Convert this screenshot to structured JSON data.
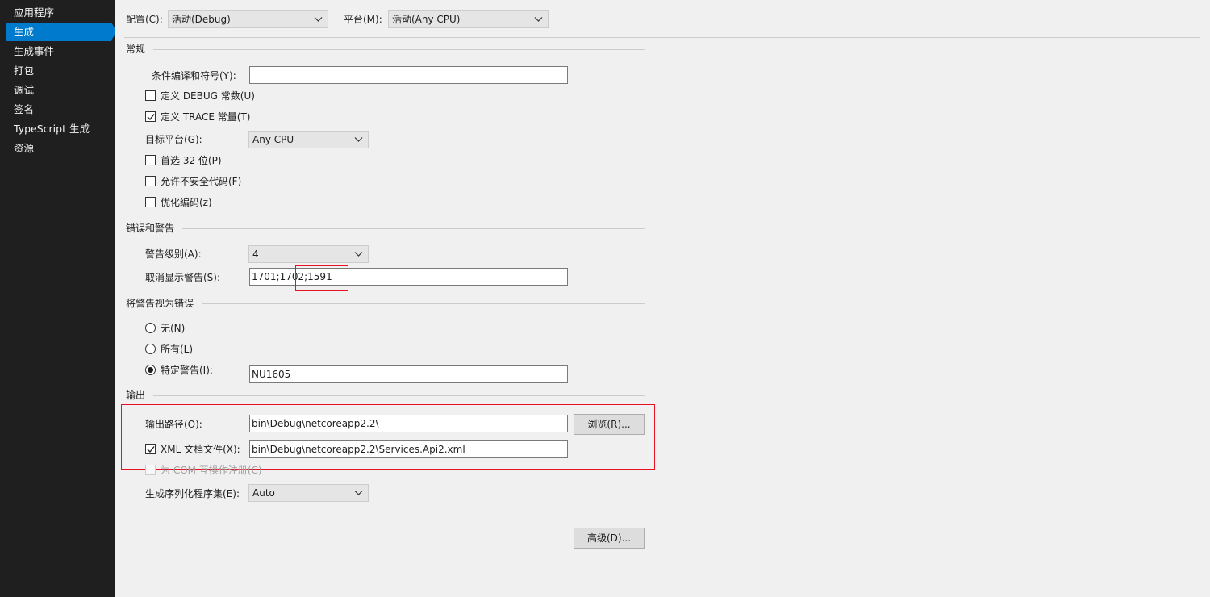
{
  "sidebar": {
    "items": [
      {
        "label": "应用程序"
      },
      {
        "label": "生成"
      },
      {
        "label": "生成事件"
      },
      {
        "label": "打包"
      },
      {
        "label": "调试"
      },
      {
        "label": "签名"
      },
      {
        "label": "TypeScript 生成"
      },
      {
        "label": "资源"
      }
    ],
    "active_index": 1
  },
  "header": {
    "config_label": "配置(C):",
    "config_value": "活动(Debug)",
    "platform_label": "平台(M):",
    "platform_value": "活动(Any CPU)"
  },
  "general": {
    "title": "常规",
    "conditional_symbols_label": "条件编译和符号(Y):",
    "conditional_symbols_value": "",
    "define_debug_label": "定义 DEBUG 常数(U)",
    "define_debug_checked": false,
    "define_trace_label": "定义 TRACE 常量(T)",
    "define_trace_checked": true,
    "target_platform_label": "目标平台(G):",
    "target_platform_value": "Any CPU",
    "prefer32_label": "首选 32 位(P)",
    "prefer32_checked": false,
    "unsafe_label": "允许不安全代码(F)",
    "unsafe_checked": false,
    "optimize_label": "优化编码(z)",
    "optimize_checked": false
  },
  "errors": {
    "title": "错误和警告",
    "warning_level_label": "警告级别(A):",
    "warning_level_value": "4",
    "suppress_label": "取消显示警告(S):",
    "suppress_value": "1701;1702;1591"
  },
  "treat_warnings": {
    "title": "将警告视为错误",
    "none_label": "无(N)",
    "all_label": "所有(L)",
    "specific_label": "特定警告(I):",
    "specific_value": "NU1605",
    "selected": "specific"
  },
  "output": {
    "title": "输出",
    "path_label": "输出路径(O):",
    "path_value": "bin\\Debug\\netcoreapp2.2\\",
    "browse_label": "浏览(R)...",
    "xml_label": "XML 文档文件(X):",
    "xml_checked": true,
    "xml_value": "bin\\Debug\\netcoreapp2.2\\Services.Api2.xml",
    "com_label": "为 COM 互操作注册(C)",
    "serialization_label": "生成序列化程序集(E):",
    "serialization_value": "Auto",
    "advanced_label": "高级(D)..."
  },
  "colors": {
    "sidebar_bg": "#1f1f1f",
    "active_item": "#007acc",
    "highlight_border": "#e81123"
  }
}
